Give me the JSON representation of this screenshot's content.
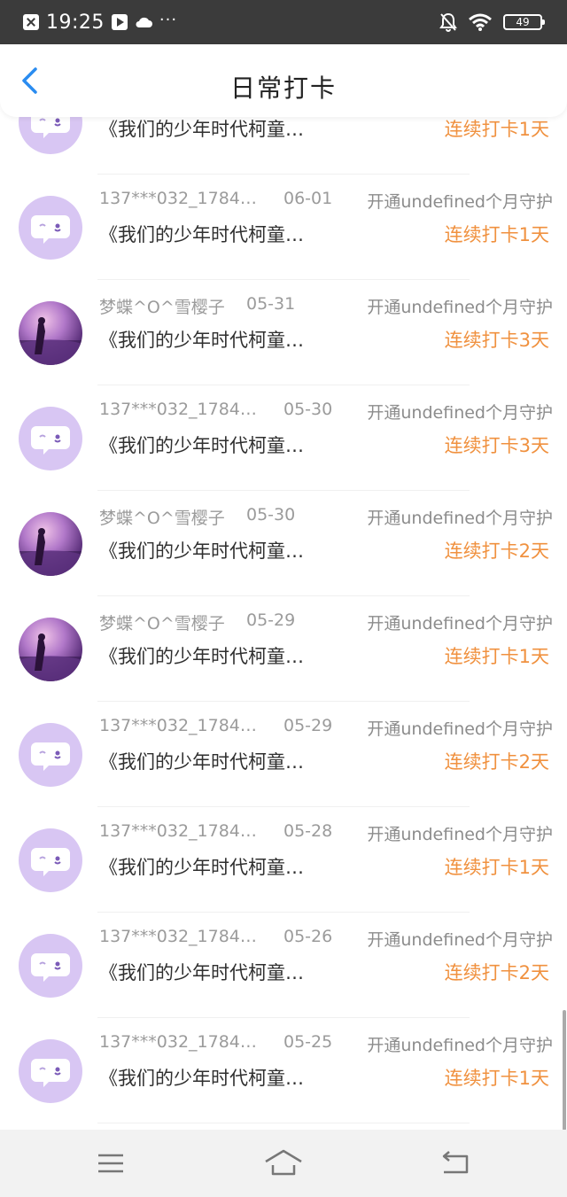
{
  "status_bar": {
    "time": "19:25",
    "battery": "49",
    "icons": [
      "close-box-icon",
      "play-icon",
      "cloud-icon",
      "more-dots-icon",
      "bell-off-icon",
      "wifi-icon",
      "battery-icon"
    ]
  },
  "header": {
    "title": "日常打卡",
    "back_icon": "chevron-left-icon"
  },
  "colors": {
    "accent": "#f0913f",
    "back_icon": "#2a8cf0",
    "avatar_bg": "#d8c6f3"
  },
  "entries": [
    {
      "name": "",
      "date": "",
      "plan": "",
      "content": "《我们的少年时代柯童…",
      "streak": "连续打卡1天",
      "avatar": "chat-bubble-icon"
    },
    {
      "name": "137***032_1784…",
      "date": "06-01",
      "plan": "开通undefined个月守护",
      "content": "《我们的少年时代柯童…",
      "streak": "连续打卡1天",
      "avatar": "chat-bubble-icon"
    },
    {
      "name": "梦蝶^O^雪樱子",
      "date": "05-31",
      "plan": "开通undefined个月守护",
      "content": "《我们的少年时代柯童…",
      "streak": "连续打卡3天",
      "avatar": "photo"
    },
    {
      "name": "137***032_1784…",
      "date": "05-30",
      "plan": "开通undefined个月守护",
      "content": "《我们的少年时代柯童…",
      "streak": "连续打卡3天",
      "avatar": "chat-bubble-icon"
    },
    {
      "name": "梦蝶^O^雪樱子",
      "date": "05-30",
      "plan": "开通undefined个月守护",
      "content": "《我们的少年时代柯童…",
      "streak": "连续打卡2天",
      "avatar": "photo"
    },
    {
      "name": "梦蝶^O^雪樱子",
      "date": "05-29",
      "plan": "开通undefined个月守护",
      "content": "《我们的少年时代柯童…",
      "streak": "连续打卡1天",
      "avatar": "photo"
    },
    {
      "name": "137***032_1784…",
      "date": "05-29",
      "plan": "开通undefined个月守护",
      "content": "《我们的少年时代柯童…",
      "streak": "连续打卡2天",
      "avatar": "chat-bubble-icon"
    },
    {
      "name": "137***032_1784…",
      "date": "05-28",
      "plan": "开通undefined个月守护",
      "content": "《我们的少年时代柯童…",
      "streak": "连续打卡1天",
      "avatar": "chat-bubble-icon"
    },
    {
      "name": "137***032_1784…",
      "date": "05-26",
      "plan": "开通undefined个月守护",
      "content": "《我们的少年时代柯童…",
      "streak": "连续打卡2天",
      "avatar": "chat-bubble-icon"
    },
    {
      "name": "137***032_1784…",
      "date": "05-25",
      "plan": "开通undefined个月守护",
      "content": "《我们的少年时代柯童…",
      "streak": "连续打卡1天",
      "avatar": "chat-bubble-icon"
    }
  ],
  "nav_bar": {
    "icons": [
      "menu-icon",
      "home-icon",
      "back-icon"
    ]
  }
}
